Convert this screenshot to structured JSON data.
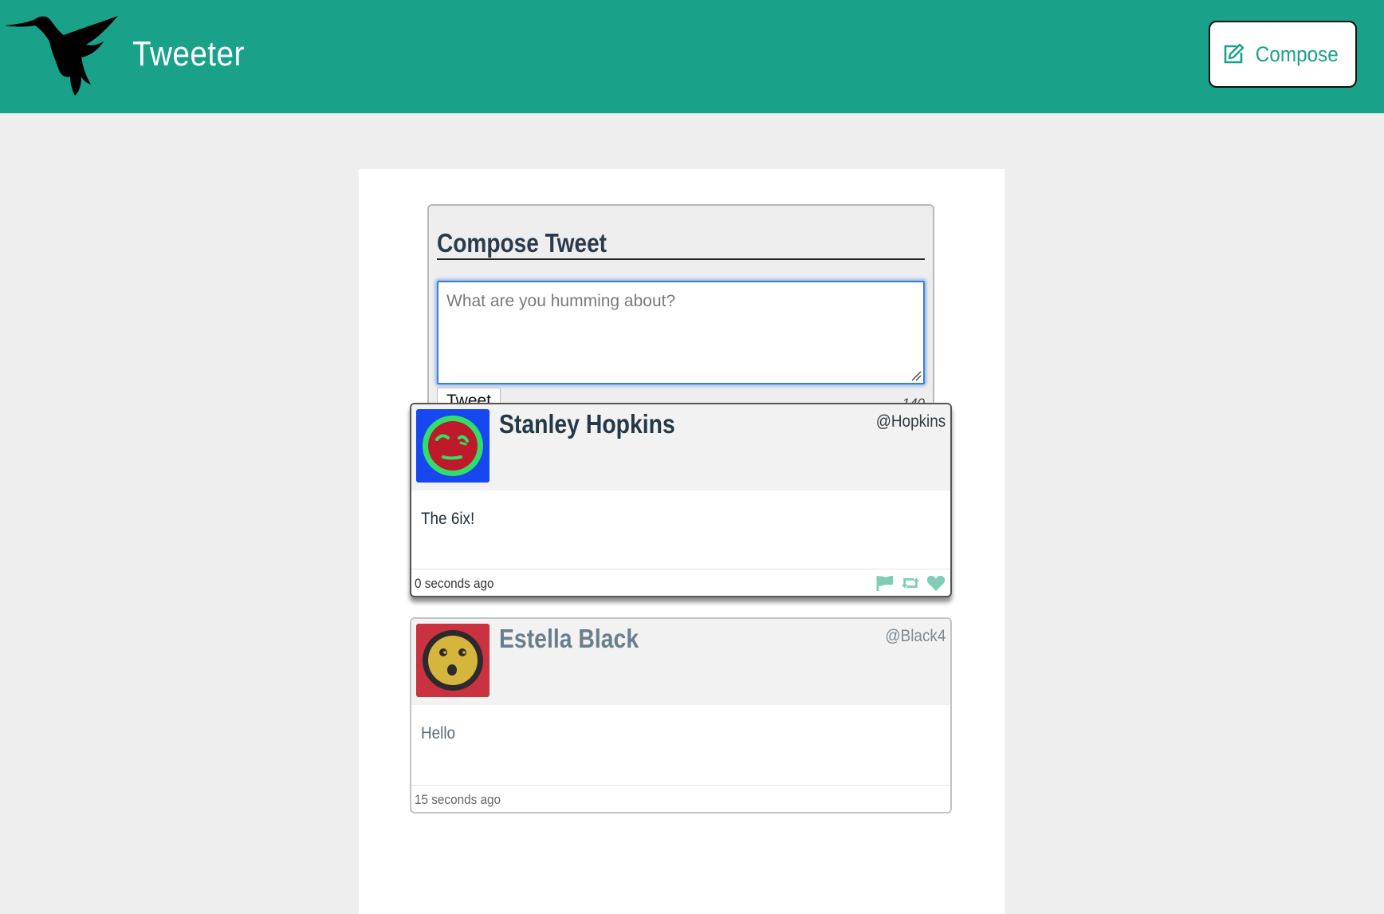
{
  "header": {
    "brand": "Tweeter",
    "compose_label": "Compose",
    "accent_color": "#1aa189"
  },
  "composer": {
    "title": "Compose Tweet",
    "placeholder": "What are you humming about?",
    "value": "",
    "submit_label": "Tweet",
    "char_counter": "140"
  },
  "tweets": [
    {
      "name": "Stanley Hopkins",
      "handle": "@Hopkins",
      "content": "The 6ix!",
      "time": "0 seconds ago",
      "avatar_icon": "green-smirk-face-avatar",
      "actions": [
        "flag-icon",
        "retweet-icon",
        "heart-icon"
      ]
    },
    {
      "name": "Estella Black",
      "handle": "@Black4",
      "content": "Hello",
      "time": "15 seconds ago",
      "avatar_icon": "yellow-surprised-face-avatar"
    }
  ]
}
